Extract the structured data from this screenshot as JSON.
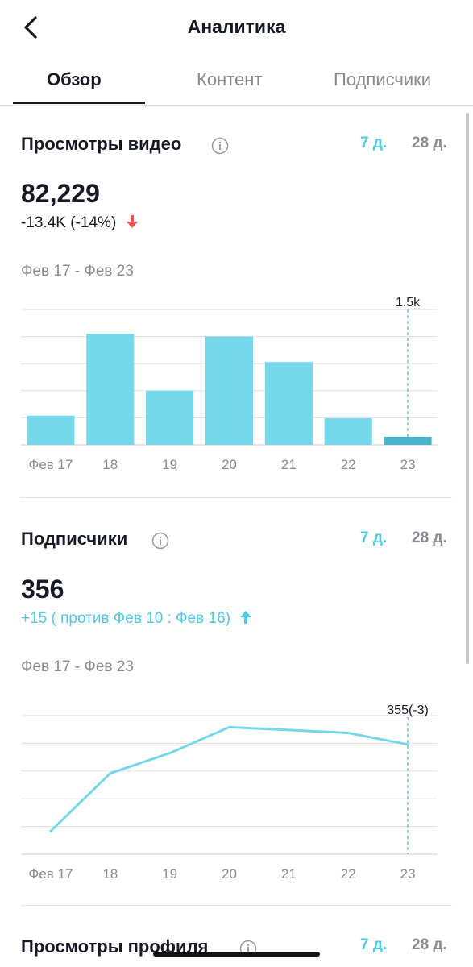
{
  "header": {
    "title": "Аналитика"
  },
  "tabs": [
    {
      "label": "Обзор",
      "active": true
    },
    {
      "label": "Контент",
      "active": false
    },
    {
      "label": "Подписчики",
      "active": false
    }
  ],
  "views": {
    "title": "Просмотры видео",
    "period_7": "7 д.",
    "period_28": "28 д.",
    "total": "82,229",
    "change": "-13.4K (-14%)",
    "change_color": "#f0544f",
    "date_range": "Фев 17 - Фев 23",
    "chart_data": {
      "type": "bar",
      "categories": [
        "Фев 17",
        "18",
        "19",
        "20",
        "21",
        "22",
        "23"
      ],
      "values": [
        540,
        2050,
        1000,
        2000,
        1530,
        490,
        150
      ],
      "highlight_index": 6,
      "tooltip": "1.5k",
      "ylim": [
        0,
        2500
      ],
      "grid": true,
      "bar_color": "#76d7ea",
      "highlight_color": "#4ab4cc"
    }
  },
  "followers": {
    "title": "Подписчики",
    "period_7": "7 д.",
    "period_28": "28 д.",
    "total": "356",
    "change": "+15 ( против Фев 10 : Фев 16)",
    "change_color": "#4ec9df",
    "date_range": "Фев 17 - Фев 23",
    "chart_data": {
      "type": "line",
      "categories": [
        "Фев 17",
        "18",
        "19",
        "20",
        "21",
        "22",
        "23"
      ],
      "values": [
        340,
        350,
        353.5,
        358,
        357.5,
        357,
        355
      ],
      "highlight_index": 6,
      "tooltip": "355(-3)",
      "ylim": [
        336,
        360
      ],
      "grid": true,
      "line_color": "#76d7ea"
    }
  },
  "profile_views": {
    "title": "Просмотры профиля",
    "period_7": "7 д.",
    "period_28": "28 д."
  }
}
